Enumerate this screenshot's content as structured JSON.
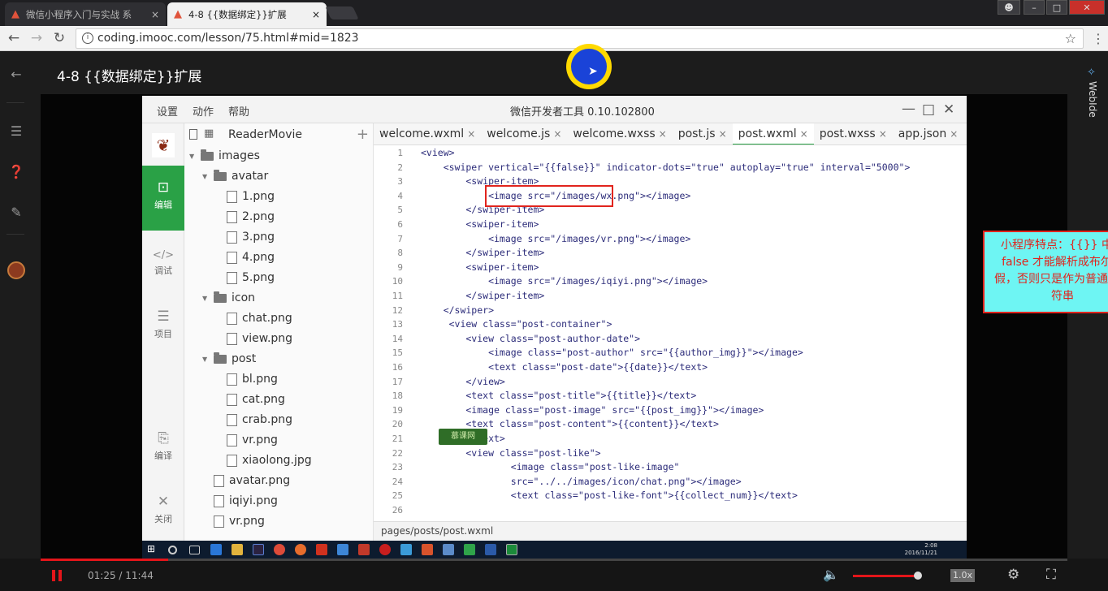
{
  "browser": {
    "tabs": [
      {
        "title": "微信小程序入门与实战 系",
        "close": "×"
      },
      {
        "title": "4-8 {{数据绑定}}扩展",
        "close": "×"
      }
    ],
    "window_controls": {
      "minimize": "–",
      "maximize": "□",
      "close": "✕"
    },
    "address": "coding.imooc.com/lesson/75.html#mid=1823"
  },
  "site": {
    "lesson_title": "4-8 {{数据绑定}}扩展",
    "right_panel_label": "WebIde"
  },
  "ide": {
    "menu": [
      "设置",
      "动作",
      "帮助"
    ],
    "title": "微信开发者工具 0.10.102800",
    "rail": [
      {
        "label": "编辑",
        "icon": "code-icon",
        "glyph": "⊡"
      },
      {
        "label": "调试",
        "icon": "debug-icon",
        "glyph": "</>"
      },
      {
        "label": "项目",
        "icon": "project-icon",
        "glyph": "☰"
      },
      {
        "label": "编译",
        "icon": "compile-icon",
        "glyph": "⎘"
      },
      {
        "label": "关闭",
        "icon": "close-icon",
        "glyph": "✕"
      }
    ],
    "project_name": "ReaderMovie",
    "tree": [
      {
        "name": "images",
        "type": "folder",
        "depth": 0
      },
      {
        "name": "avatar",
        "type": "folder",
        "depth": 1
      },
      {
        "name": "1.png",
        "type": "file",
        "depth": 2
      },
      {
        "name": "2.png",
        "type": "file",
        "depth": 2
      },
      {
        "name": "3.png",
        "type": "file",
        "depth": 2
      },
      {
        "name": "4.png",
        "type": "file",
        "depth": 2
      },
      {
        "name": "5.png",
        "type": "file",
        "depth": 2
      },
      {
        "name": "icon",
        "type": "folder",
        "depth": 1
      },
      {
        "name": "chat.png",
        "type": "file",
        "depth": 2
      },
      {
        "name": "view.png",
        "type": "file",
        "depth": 2
      },
      {
        "name": "post",
        "type": "folder",
        "depth": 1
      },
      {
        "name": "bl.png",
        "type": "file",
        "depth": 2
      },
      {
        "name": "cat.png",
        "type": "file",
        "depth": 2
      },
      {
        "name": "crab.png",
        "type": "file",
        "depth": 2
      },
      {
        "name": "vr.png",
        "type": "file",
        "depth": 2
      },
      {
        "name": "xiaolong.jpg",
        "type": "file",
        "depth": 2
      },
      {
        "name": "avatar.png",
        "type": "file",
        "depth": 1
      },
      {
        "name": "iqiyi.png",
        "type": "file",
        "depth": 1
      },
      {
        "name": "vr.png",
        "type": "file",
        "depth": 1
      }
    ],
    "editor_tabs": [
      {
        "label": "welcome.wxml",
        "close": "×"
      },
      {
        "label": "welcome.js",
        "close": "×"
      },
      {
        "label": "welcome.wxss",
        "close": "×"
      },
      {
        "label": "post.js",
        "close": "×"
      },
      {
        "label": "post.wxml",
        "close": "×",
        "active": true
      },
      {
        "label": "post.wxss",
        "close": "×"
      },
      {
        "label": "app.json",
        "close": "×"
      }
    ],
    "code_lines": [
      "<view>",
      "    <swiper vertical=\"{{false}}\" indicator-dots=\"true\" autoplay=\"true\" interval=\"5000\">",
      "        <swiper-item>",
      "            <image src=\"/images/wx.png\"></image>",
      "        </swiper-item>",
      "        <swiper-item>",
      "            <image src=\"/images/vr.png\"></image>",
      "        </swiper-item>",
      "        <swiper-item>",
      "            <image src=\"/images/iqiyi.png\"></image>",
      "        </swiper-item>",
      "    </swiper>",
      "     <view class=\"post-container\">",
      "        <view class=\"post-author-date\">",
      "            <image class=\"post-author\" src=\"{{author_img}}\"></image>",
      "            <text class=\"post-date\">{{date}}</text>",
      "        </view>",
      "        <text class=\"post-title\">{{title}}</text>",
      "        <image class=\"post-image\" src=\"{{post_img}}\"></image>",
      "        <text class=\"post-content\">{{content}}</text>",
      "        </text>",
      "        <view class=\"post-like\">",
      "                <image class=\"post-like-image\"",
      "                src=\"../../images/icon/chat.png\"></image>",
      "                <text class=\"post-like-font\">{{collect_num}}</text>",
      ""
    ],
    "note": "小程序特点：{{}} 中放false 才能解析成布尔值假，否则只是作为普通的字符串",
    "status_path": "pages/posts/post.wxml",
    "watermark": "慕课网"
  },
  "taskbar": {
    "clock": "2:08\n2016/11/21"
  },
  "player": {
    "time": "01:25 / 11:44",
    "progress_fraction": 0.124,
    "volume_fraction": 0.95,
    "speed": "1.0x"
  }
}
